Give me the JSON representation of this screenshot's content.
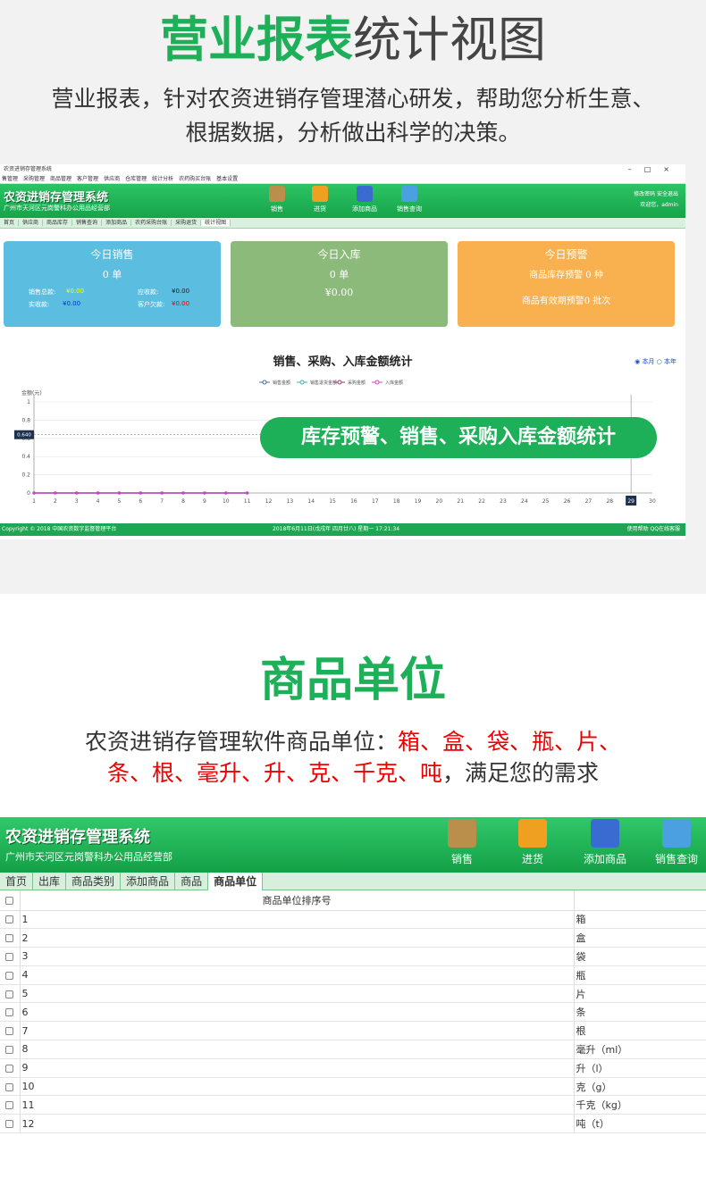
{
  "section1": {
    "title_green": "营业报表",
    "title_gray": "统计视图",
    "subtitle_line1": "营业报表，针对农资进销存管理潜心研发，帮助您分析生意、",
    "subtitle_line2": "根据数据，分析做出科学的决策。"
  },
  "window": {
    "title": "农资进销存管理系统",
    "controls": "–□×",
    "menu": [
      "售管理",
      "采购管理",
      "商品管理",
      "客户管理",
      "供应商",
      "仓库管理",
      "统计分析",
      "农药购买台账",
      "基本设置"
    ],
    "app_title": "农资进销存管理系统",
    "app_sub": "广州市天河区元岗警科办公用品经营部",
    "tools": [
      "销售",
      "进货",
      "添加商品",
      "销售查询"
    ],
    "user_links": "修改密码  安全退出",
    "user_welcome": "欢迎您，admin",
    "tabs": [
      "首页",
      "供应商",
      "商品库存",
      "销售查询",
      "添加商品",
      "农药采购台账",
      "采购退货",
      "统计视图"
    ],
    "active_tab": "统计视图",
    "cards": {
      "sales": {
        "title": "今日销售",
        "value": "0 单",
        "total_label": "销售总款:",
        "total": "¥0.00",
        "receivable_label": "应收款:",
        "receivable": "¥0.00",
        "received_label": "实收款:",
        "received": "¥0.00",
        "debt_label": "客户欠款:",
        "debt": "¥0.00",
        "color": "#5bbde0"
      },
      "stock": {
        "title": "今日入库",
        "value": "0 单",
        "amount": "¥0.00",
        "color": "#8cba7a"
      },
      "alert": {
        "title": "今日预警",
        "line1": "商品库存预警 0 种",
        "line2": "商品有效期预警0 批次",
        "color": "#f8b14e"
      }
    },
    "status_left": "Copyright © 2018 中国农资数字监督管理平台",
    "status_mid": "2018年6月11日(戊戌年 四月廿八) 星期一 17:21:34",
    "status_right": "使用帮助  QQ在线客服"
  },
  "banner": "库存预警、销售、采购入库金额统计",
  "chart_data": {
    "type": "line",
    "title": "销售、采购、入库金额统计",
    "period_options": [
      "本月",
      "本年"
    ],
    "selected_period": "本月",
    "ylabel": "金额(元)",
    "ylim": [
      0,
      1
    ],
    "yticks": [
      "0",
      "0.2",
      "0.4",
      "0.6",
      "0.8",
      "1"
    ],
    "crosshair_y_label": "0.640",
    "crosshair_x_label": "29",
    "x": [
      "1",
      "2",
      "3",
      "4",
      "5",
      "6",
      "7",
      "8",
      "9",
      "10",
      "11",
      "12",
      "13",
      "14",
      "15",
      "16",
      "17",
      "18",
      "19",
      "20",
      "21",
      "22",
      "23",
      "24",
      "25",
      "26",
      "27",
      "28",
      "29",
      "30"
    ],
    "series": [
      {
        "name": "销售金额",
        "color": "#4a6a9a",
        "values": [
          0,
          0,
          0,
          0,
          0,
          0,
          0,
          0,
          0,
          0,
          0
        ]
      },
      {
        "name": "销售退货金额",
        "color": "#3ab0c0",
        "values": [
          0,
          0,
          0,
          0,
          0,
          0,
          0,
          0,
          0,
          0,
          0
        ]
      },
      {
        "name": "采购金额",
        "color": "#a0306a",
        "values": [
          0,
          0,
          0,
          0,
          0,
          0,
          0,
          0,
          0,
          0,
          0
        ]
      },
      {
        "name": "入库金额",
        "color": "#d040c0",
        "values": [
          0,
          0,
          0,
          0,
          0,
          0,
          0,
          0,
          0,
          0,
          0
        ]
      }
    ]
  },
  "section2": {
    "title": "商品单位",
    "line1_prefix": "农资进销存管理软件商品单位：",
    "line1_units": "箱、盒、袋、瓶、片、",
    "line2_units": "条、根、毫升、升、克、千克、吨",
    "line2_suffix": "，满足您的需求"
  },
  "app2": {
    "app_title": "农资进销存管理系统",
    "app_sub": "广州市天河区元岗警科办公用品经营部",
    "tools": [
      "销售",
      "进货",
      "添加商品",
      "销售查询"
    ],
    "tabs": [
      "首页",
      "出库",
      "商品类别",
      "添加商品",
      "商品",
      "商品单位"
    ],
    "active_tab": "商品单位",
    "table_header": "商品单位排序号",
    "rows": [
      {
        "n": "1",
        "unit": "箱"
      },
      {
        "n": "2",
        "unit": "盒"
      },
      {
        "n": "3",
        "unit": "袋"
      },
      {
        "n": "4",
        "unit": "瓶"
      },
      {
        "n": "5",
        "unit": "片"
      },
      {
        "n": "6",
        "unit": "条"
      },
      {
        "n": "7",
        "unit": "根"
      },
      {
        "n": "8",
        "unit": "毫升（ml）"
      },
      {
        "n": "9",
        "unit": "升（l）"
      },
      {
        "n": "10",
        "unit": "克（g）"
      },
      {
        "n": "11",
        "unit": "千克（kg）"
      },
      {
        "n": "12",
        "unit": "吨（t）"
      }
    ]
  }
}
